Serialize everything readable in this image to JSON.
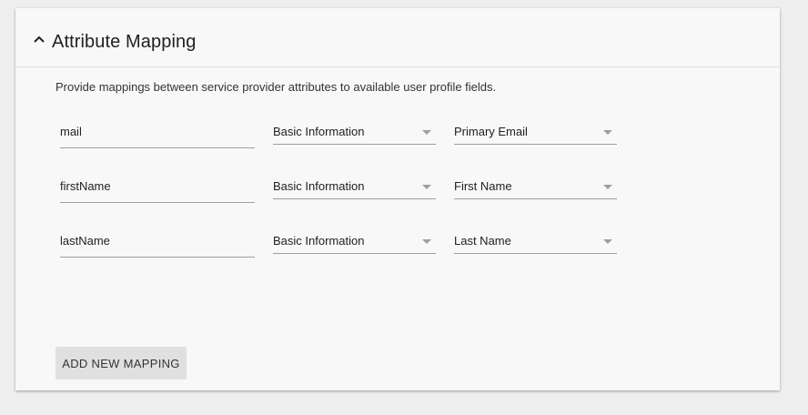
{
  "section": {
    "title": "Attribute Mapping",
    "expanded_icon": "chevron-up-icon",
    "description": "Provide mappings between service provider attributes to available user profile fields."
  },
  "mappings": [
    {
      "attribute": "mail",
      "category": "Basic Information",
      "field": "Primary Email"
    },
    {
      "attribute": "firstName",
      "category": "Basic Information",
      "field": "First Name"
    },
    {
      "attribute": "lastName",
      "category": "Basic Information",
      "field": "Last Name"
    }
  ],
  "actions": {
    "add_label": "ADD NEW MAPPING"
  },
  "colors": {
    "page_background": "#eeeeee",
    "card_background": "#f8f8f8",
    "button_background": "#e0e0e0",
    "underline": "#9e9e9e"
  }
}
